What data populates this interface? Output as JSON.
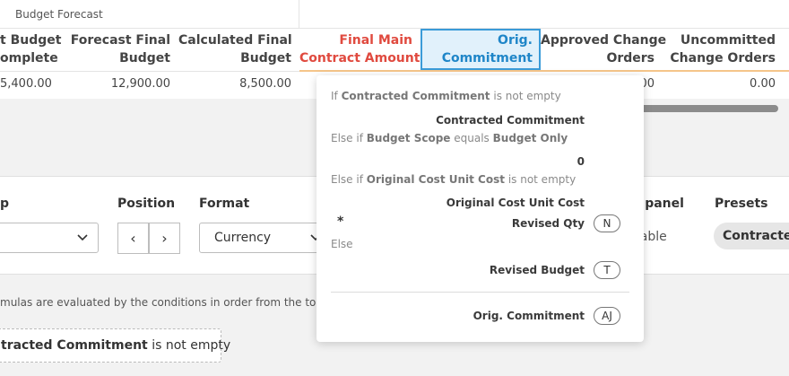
{
  "grid": {
    "group_label": "Budget Forecast",
    "columns": [
      {
        "line1": "t Budget",
        "line2": "omplete"
      },
      {
        "line1": "Forecast Final",
        "line2": "Budget"
      },
      {
        "line1": "Calculated Final",
        "line2": "Budget"
      },
      {
        "line1": "Final Main",
        "line2": "Contract Amount"
      },
      {
        "line1": "Orig.",
        "line2": "Commitment"
      },
      {
        "line1": "Approved Change",
        "line2": "Orders"
      },
      {
        "line1": "Uncommitted",
        "line2": "Change Orders"
      }
    ],
    "row": [
      "5,400.00",
      "12,900.00",
      "8,500.00",
      ".00",
      "0.00"
    ]
  },
  "panel": {
    "group_label": "p",
    "position_label": "Position",
    "format_label": "Format",
    "format_value": "Currency",
    "prev_glyph": "‹",
    "next_glyph": "›",
    "panel_label": "s panel",
    "availability": "ilable",
    "presets_label": "Presets",
    "preset_chip": "Contracted",
    "help_text": "mulas are evaluated by the conditions in order from the top dov",
    "condition_field": "tracted Commitment",
    "condition_op": "is not empty"
  },
  "popup": {
    "if_kw": "If",
    "if_field": "Contracted Commitment",
    "if_op": "is not empty",
    "result1": "Contracted Commitment",
    "elseif1_kw": "Else if",
    "elseif1_field": "Budget Scope",
    "elseif1_op": "equals",
    "elseif1_value": "Budget Only",
    "result2": "0",
    "elseif2_kw": "Else if",
    "elseif2_field": "Original Cost Unit Cost",
    "elseif2_op": "is not empty",
    "result3a": "Original Cost Unit Cost",
    "mult": "*",
    "result3b": "Revised Qty",
    "pill_n": "N",
    "else_kw": "Else",
    "result4": "Revised Budget",
    "pill_t": "T",
    "footer_field": "Orig. Commitment",
    "pill_aj": "AJ"
  }
}
